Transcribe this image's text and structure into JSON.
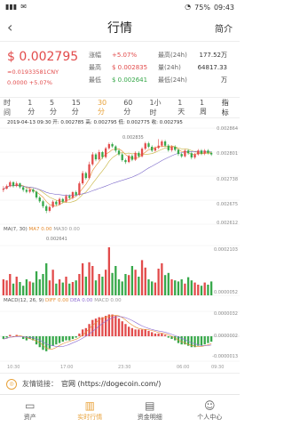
{
  "status_bar": {
    "battery": "75%",
    "time": "09:43"
  },
  "header": {
    "title": "行情",
    "right_label": "简介",
    "back_icon": "chevron-left-icon"
  },
  "summary": {
    "price": "$ 0.002795",
    "price_cny": "≈0.01933581CNY",
    "change_line": "0.0000 +5.07%",
    "labels": {
      "change": "涨幅",
      "high": "最高",
      "low": "最低",
      "high24": "最高(24h)",
      "vol24": "量(24h)",
      "low24": "最低(24h)"
    },
    "values": {
      "change": "+5.07%",
      "high": "$ 0.002835",
      "low": "$ 0.002641",
      "high24_val": "177.52万",
      "vol24_val": "64817.33",
      "low24_val": "万"
    }
  },
  "tabs": {
    "time": "时间",
    "items": [
      "1分",
      "5分",
      "15分",
      "30分",
      "60分",
      "1小时",
      "1天",
      "1周"
    ],
    "active": "30分",
    "index": "指标"
  },
  "chart_data": {
    "type": "candlestick",
    "ohlc_text": "2019-04-13 09:30 开: 0.002785 高: 0.002795 低: 0.002775 收: 0.002795",
    "y_labels": [
      "0.002864",
      "0.002801",
      "0.002738",
      "0.002675",
      "0.002612"
    ],
    "x_labels": [
      "10:30",
      "17:00",
      "23:30",
      "06:00",
      "09:30"
    ],
    "high_mark": "0.002835",
    "low_mark": "0.002641",
    "candles": [
      [
        0.002702,
        0.002705,
        0.002712,
        0.002696
      ],
      [
        0.002705,
        0.002712,
        0.002716,
        0.002703
      ],
      [
        0.002712,
        0.002722,
        0.002726,
        0.002709
      ],
      [
        0.002722,
        0.002712,
        0.002725,
        0.002708
      ],
      [
        0.002712,
        0.002719,
        0.002724,
        0.002709
      ],
      [
        0.002719,
        0.002709,
        0.002721,
        0.002705
      ],
      [
        0.002709,
        0.002702,
        0.002712,
        0.002697
      ],
      [
        0.002702,
        0.002697,
        0.002707,
        0.002693
      ],
      [
        0.002697,
        0.002703,
        0.002707,
        0.002693
      ],
      [
        0.002703,
        0.002697,
        0.002706,
        0.002693
      ],
      [
        0.002697,
        0.002682,
        0.0027,
        0.002677
      ],
      [
        0.002682,
        0.002672,
        0.002686,
        0.002668
      ],
      [
        0.002672,
        0.002659,
        0.002676,
        0.002654
      ],
      [
        0.002659,
        0.002647,
        0.002663,
        0.002641
      ],
      [
        0.002647,
        0.002657,
        0.002661,
        0.002643
      ],
      [
        0.002657,
        0.002671,
        0.002675,
        0.002654
      ],
      [
        0.002671,
        0.002664,
        0.002674,
        0.00266
      ],
      [
        0.002664,
        0.002678,
        0.002682,
        0.002661
      ],
      [
        0.002678,
        0.002671,
        0.002681,
        0.002667
      ],
      [
        0.002671,
        0.002686,
        0.00269,
        0.002668
      ],
      [
        0.002686,
        0.002681,
        0.00269,
        0.002677
      ],
      [
        0.002681,
        0.002696,
        0.002699,
        0.002677
      ],
      [
        0.002696,
        0.002689,
        0.0027,
        0.002685
      ],
      [
        0.002689,
        0.002719,
        0.002724,
        0.002686
      ],
      [
        0.002719,
        0.002746,
        0.002752,
        0.002715
      ],
      [
        0.002746,
        0.002733,
        0.00275,
        0.002729
      ],
      [
        0.002733,
        0.002769,
        0.002776,
        0.00273
      ],
      [
        0.002769,
        0.002795,
        0.002801,
        0.002765
      ],
      [
        0.002795,
        0.002782,
        0.002799,
        0.002777
      ],
      [
        0.002782,
        0.002801,
        0.002807,
        0.002779
      ],
      [
        0.002801,
        0.002788,
        0.002804,
        0.002783
      ],
      [
        0.002788,
        0.002811,
        0.002815,
        0.002784
      ],
      [
        0.002811,
        0.002822,
        0.002826,
        0.002807
      ],
      [
        0.002822,
        0.002816,
        0.002826,
        0.002812
      ],
      [
        0.002816,
        0.002805,
        0.002819,
        0.0028
      ],
      [
        0.002805,
        0.002795,
        0.002809,
        0.002791
      ],
      [
        0.002795,
        0.00278,
        0.002799,
        0.002776
      ],
      [
        0.00278,
        0.002775,
        0.002784,
        0.00277
      ],
      [
        0.002775,
        0.002791,
        0.002795,
        0.002772
      ],
      [
        0.002791,
        0.002781,
        0.002795,
        0.002777
      ],
      [
        0.002781,
        0.002799,
        0.002803,
        0.002778
      ],
      [
        0.002799,
        0.00279,
        0.002803,
        0.002786
      ],
      [
        0.00279,
        0.00281,
        0.002814,
        0.002787
      ],
      [
        0.00281,
        0.002824,
        0.002828,
        0.002806
      ],
      [
        0.002824,
        0.002815,
        0.002828,
        0.002811
      ],
      [
        0.002815,
        0.002805,
        0.002819,
        0.002801
      ],
      [
        0.002805,
        0.002812,
        0.002816,
        0.002802
      ],
      [
        0.002812,
        0.002818,
        0.002835,
        0.002809
      ],
      [
        0.002818,
        0.002829,
        0.002833,
        0.002814
      ],
      [
        0.002829,
        0.002818,
        0.002833,
        0.002814
      ],
      [
        0.002818,
        0.002806,
        0.002822,
        0.002802
      ],
      [
        0.002806,
        0.002815,
        0.002819,
        0.002802
      ],
      [
        0.002815,
        0.002807,
        0.002819,
        0.002803
      ],
      [
        0.002807,
        0.002796,
        0.00281,
        0.002791
      ],
      [
        0.002796,
        0.00279,
        0.0028,
        0.002786
      ],
      [
        0.00279,
        0.002805,
        0.002809,
        0.002787
      ],
      [
        0.002805,
        0.002798,
        0.002809,
        0.002794
      ],
      [
        0.002798,
        0.002787,
        0.002802,
        0.002782
      ],
      [
        0.002787,
        0.002795,
        0.002799,
        0.002783
      ],
      [
        0.002795,
        0.002805,
        0.002809,
        0.002792
      ],
      [
        0.002805,
        0.002797,
        0.002809,
        0.002793
      ],
      [
        0.002797,
        0.002805,
        0.002809,
        0.002793
      ],
      [
        0.002805,
        0.002799,
        0.002809,
        0.002795
      ],
      [
        0.002799,
        0.002795,
        0.002803,
        0.002791
      ]
    ],
    "volume": [
      30,
      28,
      40,
      22,
      35,
      25,
      18,
      30,
      26,
      24,
      45,
      30,
      40,
      60,
      28,
      48,
      22,
      30,
      24,
      35,
      22,
      25,
      28,
      40,
      60,
      35,
      62,
      55,
      28,
      40,
      35,
      48,
      90,
      42,
      55,
      30,
      26,
      40,
      38,
      55,
      48,
      35,
      66,
      52,
      30,
      26,
      24,
      50,
      60,
      38,
      42,
      30,
      28,
      26,
      30,
      22,
      34,
      28,
      24,
      20,
      18,
      24,
      20,
      26
    ],
    "macd": [
      -2,
      -1,
      1,
      0,
      1,
      0,
      -2,
      -3,
      -2,
      -3,
      -6,
      -8,
      -10,
      -11,
      -9,
      -7,
      -6,
      -5,
      -4,
      -3,
      -3,
      -2,
      -1,
      2,
      5,
      6,
      9,
      12,
      13,
      14,
      14,
      15,
      16,
      16,
      15,
      13,
      11,
      9,
      7,
      6,
      5,
      5,
      5,
      5,
      4,
      3,
      2,
      2,
      2,
      1,
      -1,
      -2,
      -3,
      -5,
      -6,
      -6,
      -7,
      -8,
      -8,
      -7,
      -7,
      -6,
      -5,
      -4
    ],
    "ma_text": {
      "vol": "MA(7, 30)",
      "ma7": "MA7 0.00",
      "ma30": "MA30 0.00"
    },
    "macd_text": {
      "params": "MACD(12, 26, 9)",
      "dif": "DIFF 0.00",
      "dea": "DEA 0.00",
      "macd": "MACD 0.00"
    },
    "macd_y_labels": [
      "0.0000032",
      "0.0000002",
      "-0.0000013"
    ],
    "vol_y_labels": [
      "0.0002103",
      "0.0000052"
    ]
  },
  "link": {
    "label": "友情链接：",
    "text": "官网 (https://dogecoin.com/)"
  },
  "bottom_nav": [
    {
      "label": "资产",
      "icon": "wallet-icon"
    },
    {
      "label": "实时行情",
      "icon": "chart-icon"
    },
    {
      "label": "资金明细",
      "icon": "ledger-icon"
    },
    {
      "label": "个人中心",
      "icon": "user-icon"
    }
  ],
  "colors": {
    "up": "#e24b4b",
    "down": "#37a84a",
    "accent": "#e8a23a"
  }
}
